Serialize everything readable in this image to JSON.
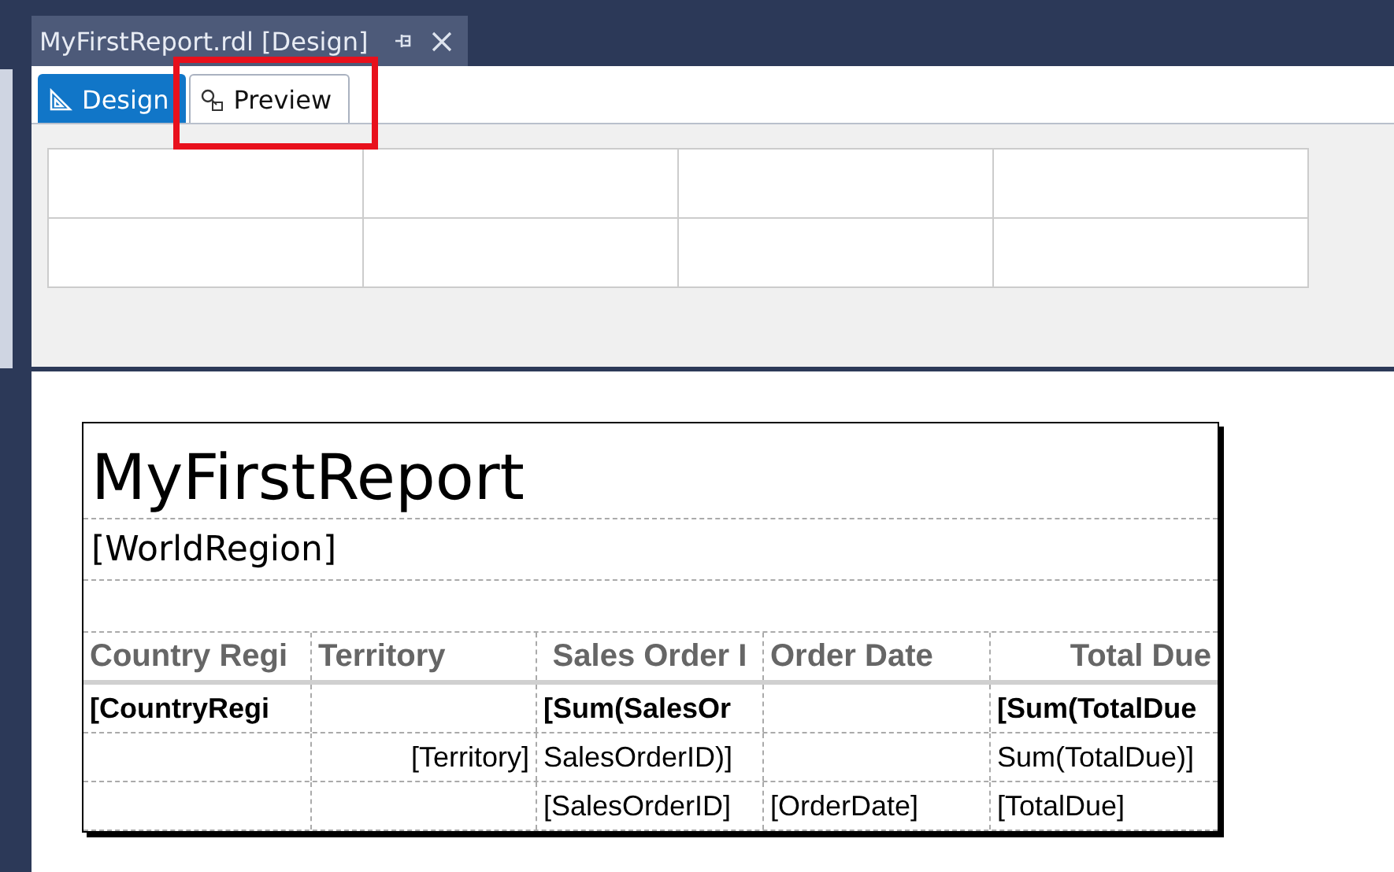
{
  "document_tab": {
    "title": "MyFirstReport.rdl [Design]"
  },
  "tabs": [
    {
      "label": "Design",
      "selected": true,
      "highlighted": false
    },
    {
      "label": "Preview",
      "selected": false,
      "highlighted": true
    }
  ],
  "report": {
    "title": "MyFirstReport",
    "subtitle": "[WorldRegion]",
    "table": {
      "columns": [
        "Country Regi",
        "Territory",
        "Sales Order I",
        "Order Date",
        "Total Due"
      ],
      "rows": [
        {
          "bold": true,
          "cells": [
            "[CountryRegi",
            null,
            "[Sum(SalesOr",
            null,
            "[Sum(TotalDue"
          ]
        },
        {
          "bold": false,
          "cells": [
            null,
            "[Territory]",
            "SalesOrderID)]",
            null,
            "Sum(TotalDue)]"
          ]
        },
        {
          "bold": false,
          "cells": [
            null,
            null,
            "[SalesOrderID]",
            "[OrderDate]",
            "[TotalDue]"
          ]
        }
      ]
    }
  }
}
